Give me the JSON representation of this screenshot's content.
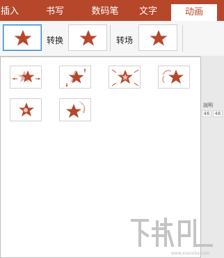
{
  "tabs": [
    {
      "label": "插入",
      "active": false
    },
    {
      "label": "书写",
      "active": false
    },
    {
      "label": "数码笔",
      "active": false
    },
    {
      "label": "文字",
      "active": false
    },
    {
      "label": "动画",
      "active": true
    }
  ],
  "ribbon": {
    "transition_label": "转换",
    "scene_change_label": "转场"
  },
  "background": {
    "header_label": "說明",
    "cells": [
      "46",
      "46"
    ]
  },
  "gallery": {
    "effects": [
      "effect-1",
      "effect-2",
      "effect-3",
      "effect-4",
      "effect-5",
      "effect-6"
    ]
  },
  "watermark": {
    "url": "www.xiazaiba.com"
  },
  "colors": {
    "accent": "#b7472a",
    "star": "#b7472a",
    "selection": "#2b88d8"
  }
}
